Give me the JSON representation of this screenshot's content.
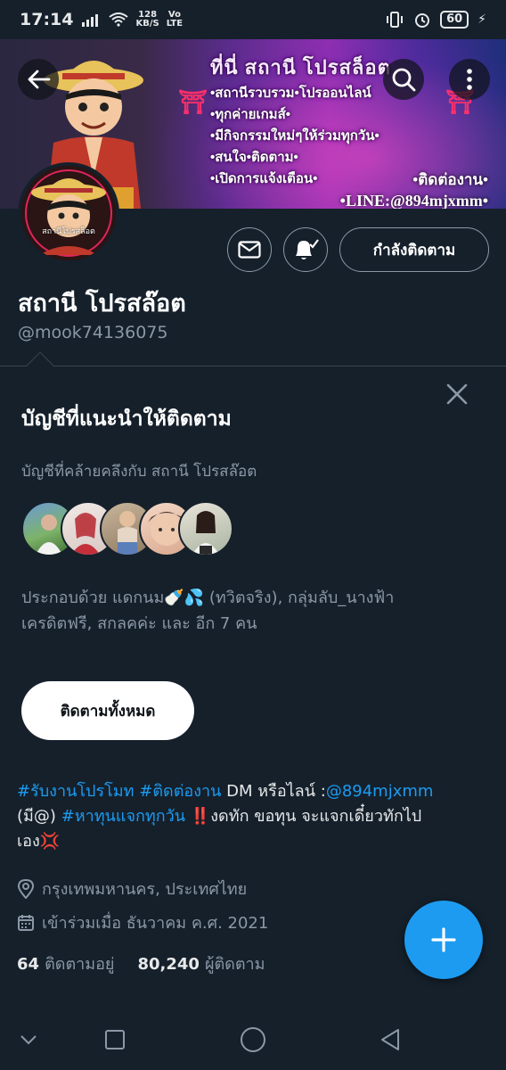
{
  "status_bar": {
    "time": "17:14",
    "net_speed": "128",
    "net_unit": "KB/S",
    "volte": "Vo",
    "lte": "LTE",
    "battery": "60"
  },
  "banner": {
    "headline": "ที่นี่ สถานี โปรสล็อต",
    "lines": [
      "•สถานีรวบรวม•โปรออนไลน์",
      "•ทุกค่ายเกมส์•",
      "•มีกิจกรรมใหม่ๆให้ร่วมทุกวัน•",
      "•สนใจ•ติดตาม•",
      "•เปิดการแจ้งเตือน•"
    ],
    "contact_label": "•ติดต่องาน•",
    "contact_line": "•LINE:@894mjxmm•"
  },
  "profile": {
    "name": "สถานี โปรสล๊อต",
    "handle": "@mook74136075",
    "following_button": "กำลังติดตาม",
    "avatar_caption": "สถานีโปรสล็อต"
  },
  "suggestions": {
    "title": "บัญชีที่แนะนำให้ติดตาม",
    "subtitle": "บัญชีที่คล้ายคลึงกับ สถานี โปรสล๊อต",
    "description_line1": "ประกอบด้วย แดกนม🍼💦 (ทวิตจริง), กลุ่มลับ_นางฟ้า",
    "description_line2": "เครดิตฟรี, สกลคค่ะ และ อีก 7 คน",
    "follow_all_button": "ติดตามทั้งหมด"
  },
  "bio": {
    "hashtag1": "#รับงานโปรโมท",
    "hashtag2": "#ติดต่องาน",
    "text1": " DM หรือไลน์ :",
    "mention": "@894mjxmm",
    "text2": "(มี@) ",
    "hashtag3": "#หาทุนแจกทุกวัน",
    "text3": " ‼️งดทัก ขอทุน จะแจกเดี๋ยวทักไป",
    "text4": "เอง💢"
  },
  "meta": {
    "location": "กรุงเทพมหานคร, ประเทศไทย",
    "joined": "เข้าร่วมเมื่อ ธันวาคม ค.ศ. 2021"
  },
  "stats": {
    "following_count": "64",
    "following_label": "ติดตามอยู่",
    "followers_count": "80,240",
    "followers_label": "ผู้ติดตาม"
  },
  "colors": {
    "background": "#15202b",
    "accent": "#1d9bf0",
    "secondary_text": "#8b98a5",
    "divider": "#38444d"
  }
}
